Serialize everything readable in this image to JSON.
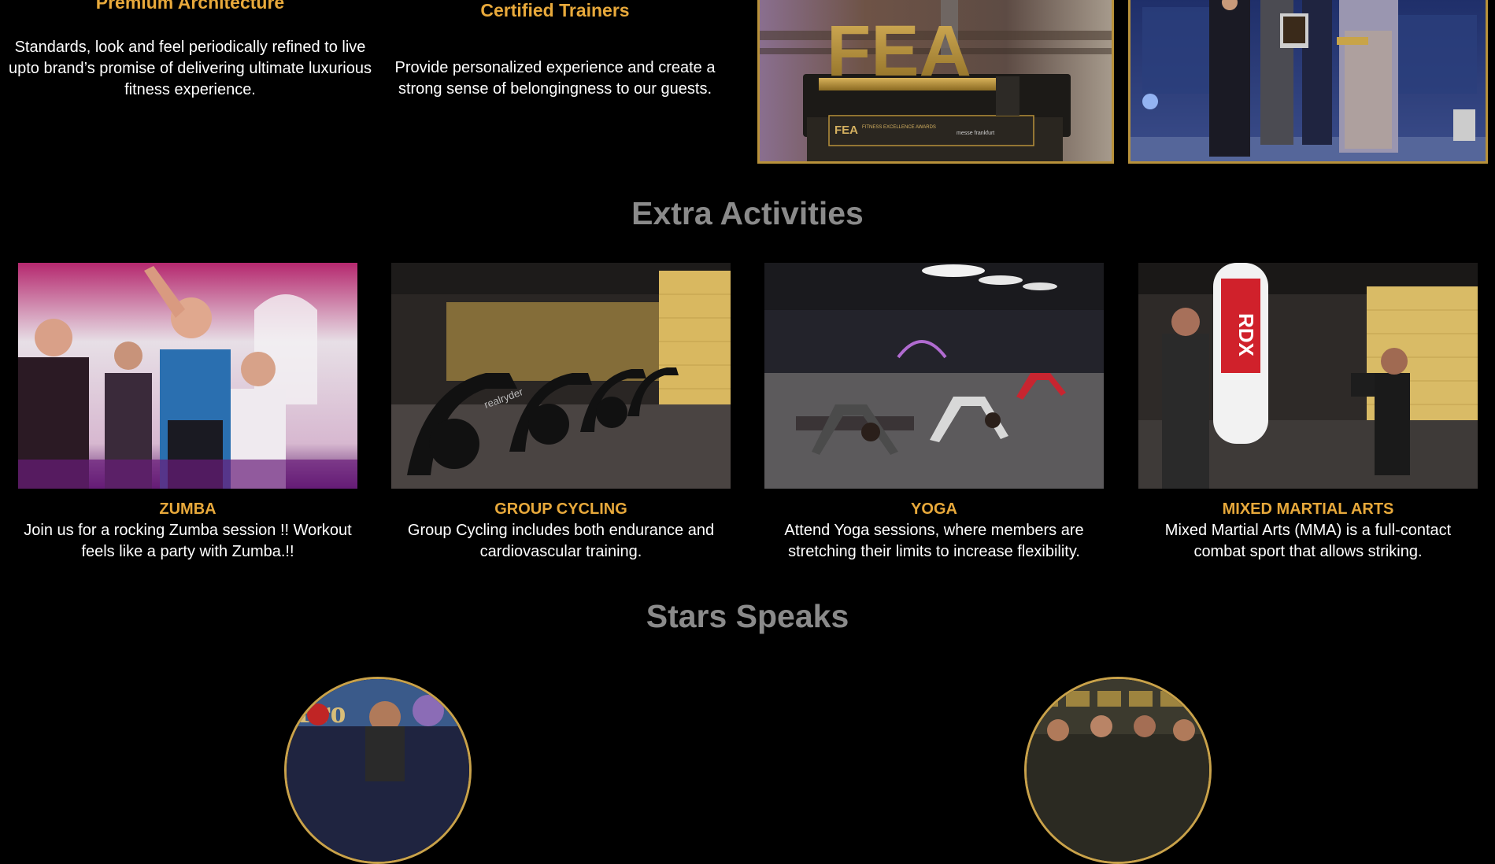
{
  "features": [
    {
      "title": "Premium Architecture",
      "text": "Standards, look and feel periodically refined to live upto brand’s promise of delivering ultimate luxurious fitness experience."
    },
    {
      "title": "Certified Trainers",
      "text": "Provide personalized experience and create a strong sense of belongingness to our guests."
    }
  ],
  "awards": {
    "trophy_logo": "FEA",
    "trophy_plaque": "FITNESS EXCELLENCE AWARDS",
    "trophy_organizer": "messe frankfurt"
  },
  "extra_activities": {
    "heading": "Extra Activities",
    "items": [
      {
        "title": "ZUMBA",
        "text": "Join us for a rocking Zumba session !! Workout feels like a party with Zumba.!!"
      },
      {
        "title": "GROUP CYCLING",
        "text": "Group Cycling includes both endurance and cardiovascular training."
      },
      {
        "title": "YOGA",
        "text": "Attend Yoga sessions, where members are stretching their limits to increase flexibility."
      },
      {
        "title": "MIXED MARTIAL ARTS",
        "text": "Mixed Martial Arts (MMA) is a full-contact combat sport that allows striking."
      }
    ]
  },
  "stars": {
    "heading": "Stars Speaks"
  },
  "colors": {
    "accent": "#e8a93b",
    "heading_gray": "#8a8a8a",
    "background": "#000000",
    "frame_gold": "#b8913a"
  }
}
